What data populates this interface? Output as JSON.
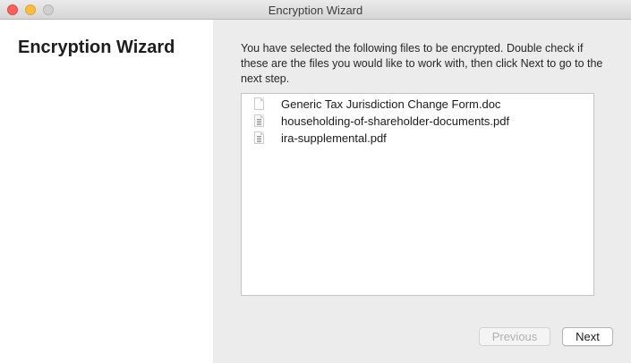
{
  "window": {
    "title": "Encryption Wizard"
  },
  "sidebar": {
    "title": "Encryption Wizard"
  },
  "main": {
    "description": "You have selected the following files to be encrypted. Double check if these are the files you would like to work with, then click Next to go to the next step.",
    "files": [
      {
        "name": "Generic Tax Jurisdiction Change Form.doc",
        "icon": "document-icon"
      },
      {
        "name": "householding-of-shareholder-documents.pdf",
        "icon": "pdf-file-icon"
      },
      {
        "name": "ira-supplemental.pdf",
        "icon": "pdf-file-icon"
      }
    ]
  },
  "buttons": {
    "previous_label": "Previous",
    "next_label": "Next"
  },
  "colors": {
    "close": "#fc605c",
    "minimize": "#fdbc40",
    "zoom_disabled": "#d0d0d0"
  }
}
